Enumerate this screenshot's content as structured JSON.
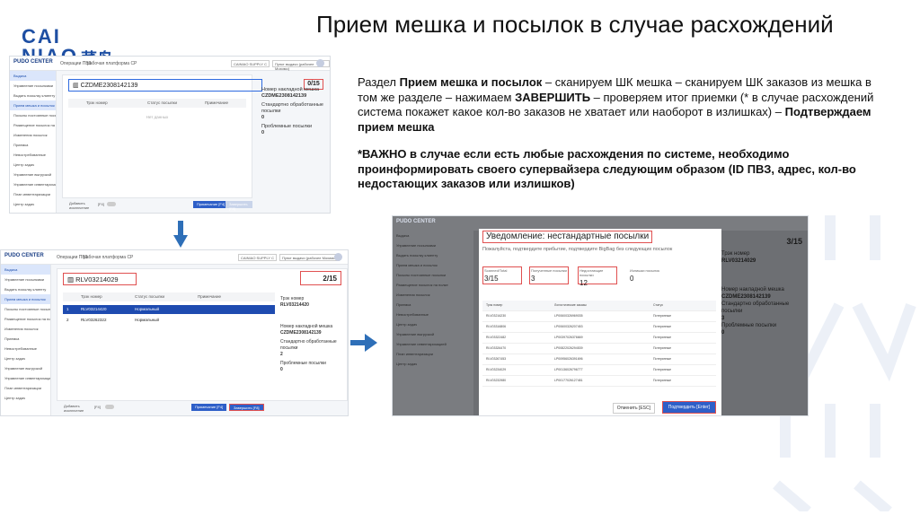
{
  "logo": {
    "line1": "CAI",
    "line2": "NIAO",
    "cn": "菜鸟"
  },
  "title": "Прием мешка и посылок в случае расхождений",
  "description": {
    "p1_a": "Раздел ",
    "p1_b": "Прием мешка и посылок",
    "p1_c": " – сканируем ШК мешка – сканируем ШК заказов из мешка в том же разделе  – нажимаем ",
    "p1_d": "ЗАВЕРШИТЬ",
    "p1_e": " – проверяем итог приемки (* в случае расхождений система покажет какое кол-во заказов не хватает или наоборот в излишках) – ",
    "p1_f": "Подтверждаем прием мешка",
    "p2": "*ВАЖНО в случае если есть любые расхождения по системе, необходимо проинформировать своего супервайзера следующим образом (ID ПВЗ, адрес, кол-во недостающих заказов или излишков)"
  },
  "shot1": {
    "brand": "PUDO CENTER",
    "tabs": [
      "Операции ПВЗ",
      "рабочая платформа CP"
    ],
    "select": "CAINIAO SUPPLY C",
    "select2": "Пункт выдачи (рабочее Мохимо)",
    "side": [
      "Выдача",
      "Управление посылками",
      "Выдать посылку клиенту",
      "Прием мешка и посылок",
      "Посылы постоянные посылки",
      "Размещение посылок на полке",
      "Изменения посылок",
      "Приемка",
      "Невостребованные",
      "Центр задач",
      "Управление выгрузкой",
      "Управление инвентаризацией",
      "План инвентаризации",
      "Центр задач"
    ],
    "scan": "CZDME2308142139",
    "count": "0/15",
    "cols": [
      "Трэк номер",
      "Статус посылки",
      "Примечание"
    ],
    "empty": "Нет данных",
    "info_label1": "Номер накладной мешка",
    "info_val1": "CZDME2308142139",
    "info_label2": "Стандартно обработанные посылки",
    "info_val2": "0",
    "info_label3": "Проблемные посылки",
    "info_val3": "0",
    "foot_add": "Добавить исключение",
    "foot_f4": "[F4]",
    "btn_note": "Примечание [F4]",
    "btn_finish": "Завершить [F8]"
  },
  "shot2": {
    "brand": "PUDO CENTER",
    "tabs": [
      "Операции ПВЗ",
      "рабочая платформа CP"
    ],
    "select": "CAINIAO SUPPLY C",
    "select2": "Пункт выдачи (рабочее Мохимо)",
    "side": [
      "Выдача",
      "Управление посылками",
      "Выдать посылку клиенту",
      "Прием мешка и посылок",
      "Посылы постоянные посылки",
      "Размещение посылок на полке",
      "Изменения посылок",
      "Приемка",
      "Невостребованные",
      "Центр задач",
      "Управление выгрузкой",
      "Управление инвентаризацией",
      "План инвентаризации",
      "Центр задач"
    ],
    "scan": "RLV03214029",
    "count": "2/15",
    "cols": [
      "Трэк номер",
      "Статус посылки",
      "Примечание"
    ],
    "rows": [
      {
        "n": "1",
        "track": "RLV03214420",
        "status": "Нормальный"
      },
      {
        "n": "2",
        "track": "RLV03262322",
        "status": "Нормальный"
      }
    ],
    "info_label0": "Трэк номер",
    "info_val0": "RLV03214420",
    "info_label1": "Номер накладной мешка",
    "info_val1": "CZDME2308142139",
    "info_label2": "Стандартно обработанные посылки",
    "info_val2": "2",
    "info_label3": "Проблемные посылки",
    "info_val3": "0",
    "foot_add": "Добавить исключение",
    "foot_f4": "[F4]",
    "btn_note": "Примечание [F4]",
    "btn_finish": "Завершить [F8]"
  },
  "shot3": {
    "brand": "PUDO CENTER",
    "side": [
      "Выдача",
      "Управление посылками",
      "Выдать посылку клиенту",
      "Прием мешка и посылок",
      "Посылы постоянные посылки",
      "Размещение посылок на полке",
      "Изменения посылок",
      "Приемка",
      "Невостребованные",
      "Центр задач",
      "Управление выгрузкой",
      "Управление инвентаризацией",
      "План инвентаризации",
      "Центр задач"
    ],
    "count": "3/15",
    "info_label0": "Трэк номер",
    "info_val0": "RLV03214029",
    "info_label1": "Номер накладной мешка",
    "info_val1": "CZDME2308142139",
    "info_label2": "Стандартно обработанные посылки",
    "info_val2": "3",
    "info_label3": "Проблемные посылки",
    "info_val3": "0",
    "dialog_title": "Уведомление: нестандартные посылки",
    "dialog_sub": "Пожалуйста, подтвердите прибытие, подтвердите BigBag без следующих посылок",
    "stats": [
      {
        "label": "Scanned/Total",
        "value": "3/15"
      },
      {
        "label": "Полученные посылки",
        "value": "3"
      },
      {
        "label": "Недостающие посылки",
        "value": "12"
      },
      {
        "label": "Излишки посылок",
        "value": "0"
      }
    ],
    "cols": [
      "Трэк номер",
      "Логистические заказы",
      "Статус"
    ],
    "rows": [
      {
        "track": "RLV03216230",
        "order": "LP00600326969035",
        "status": "Потерянные"
      },
      {
        "track": "RLV03316806",
        "order": "LP00600326207453",
        "status": "Потерянные"
      },
      {
        "track": "RLV03322482",
        "order": "LP00397026376669",
        "status": "Потерянные"
      },
      {
        "track": "RLV03326470",
        "order": "LP00822026294539",
        "status": "Потерянные"
      },
      {
        "track": "RLV03267453",
        "order": "LP00956026391696",
        "status": "Потерянные"
      },
      {
        "track": "RLV03234029",
        "order": "LP00136026796777",
        "status": "Потерянные"
      },
      {
        "track": "RLV03232980",
        "order": "LP00177026127481",
        "status": "Потерянные"
      }
    ],
    "cancel": "Отменить [ESC]",
    "confirm": "Подтвердить [Enter]"
  }
}
